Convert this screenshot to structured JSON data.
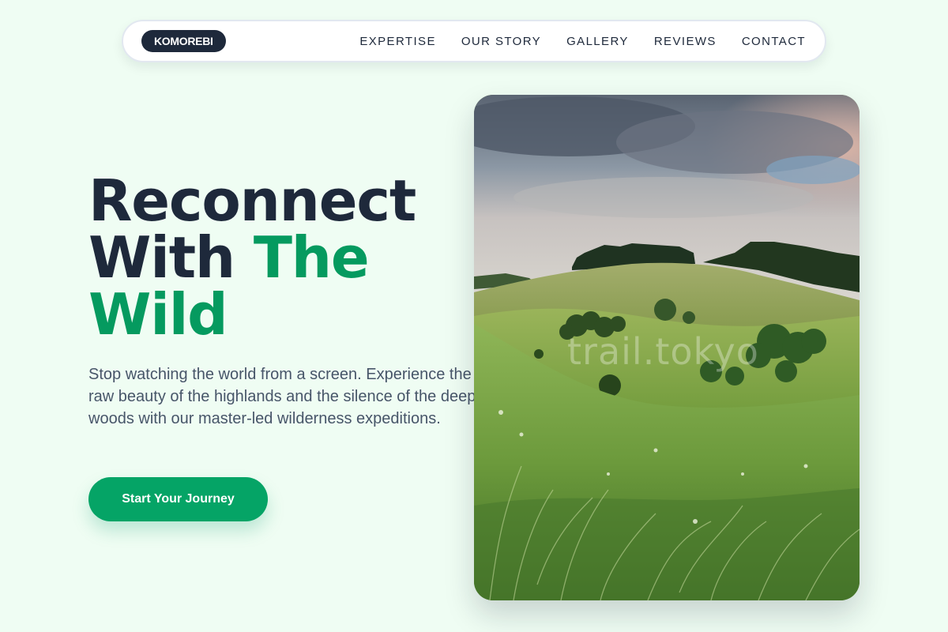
{
  "nav": {
    "brand": "KOMOREBI",
    "links": [
      {
        "label": "EXPERTISE"
      },
      {
        "label": "OUR STORY"
      },
      {
        "label": "GALLERY"
      },
      {
        "label": "REVIEWS"
      },
      {
        "label": "CONTACT"
      }
    ]
  },
  "hero": {
    "title_line1": "Reconnect",
    "title_line2_a": "With ",
    "title_line2_b": "The",
    "title_line3": "Wild",
    "description": "Stop watching the world from a screen. Experience the raw beauty of the highlands and the silence of the deep woods with our master-led wilderness expeditions.",
    "cta_label": "Start Your Journey"
  },
  "photo": {
    "watermark": "trail.tokyo",
    "alt": "rolling green hills landscape"
  },
  "colors": {
    "background": "#effdf3",
    "dark": "#1e293b",
    "accent": "#059a5f",
    "cta": "#05a466"
  }
}
